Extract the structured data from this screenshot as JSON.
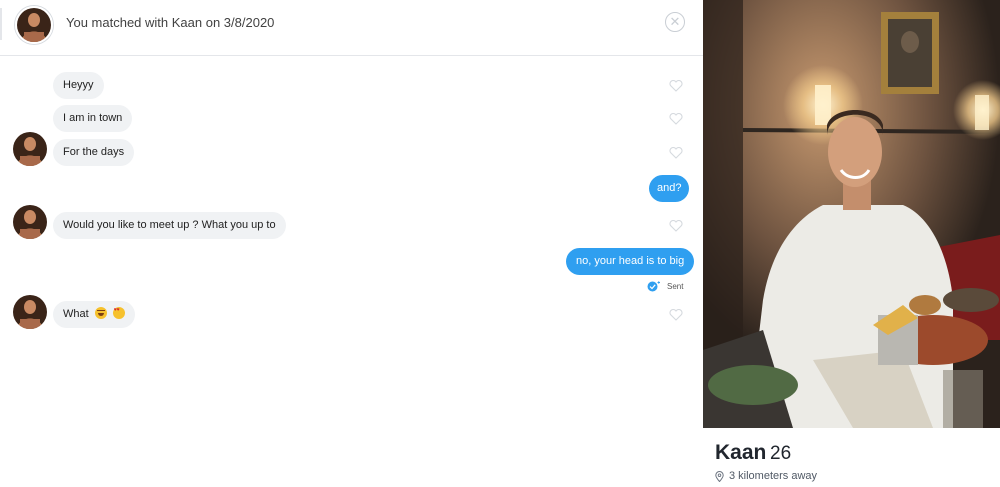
{
  "header": {
    "match_text": "You matched with Kaan on 3/8/2020",
    "close_icon": "close-icon"
  },
  "messages": [
    {
      "from": "them",
      "text": "Heyyy"
    },
    {
      "from": "them",
      "text": "I am in town"
    },
    {
      "from": "them",
      "text": "For the days"
    },
    {
      "from": "me",
      "text": "and?"
    },
    {
      "from": "them",
      "text": "Would you like to meet up ? What you up to"
    },
    {
      "from": "me",
      "text": "no, your head is to big"
    },
    {
      "from": "them",
      "text": "What",
      "emojis": [
        "laughing-emoji",
        "heart-eyes-emoji"
      ]
    }
  ],
  "status": {
    "sent_label": "Sent"
  },
  "profile": {
    "name": "Kaan",
    "age": "26",
    "distance": "3 kilometers away"
  },
  "colors": {
    "outgoing_bubble": "#2f9ff0",
    "incoming_bubble": "#f0f2f4",
    "text_dark": "#21262e"
  }
}
